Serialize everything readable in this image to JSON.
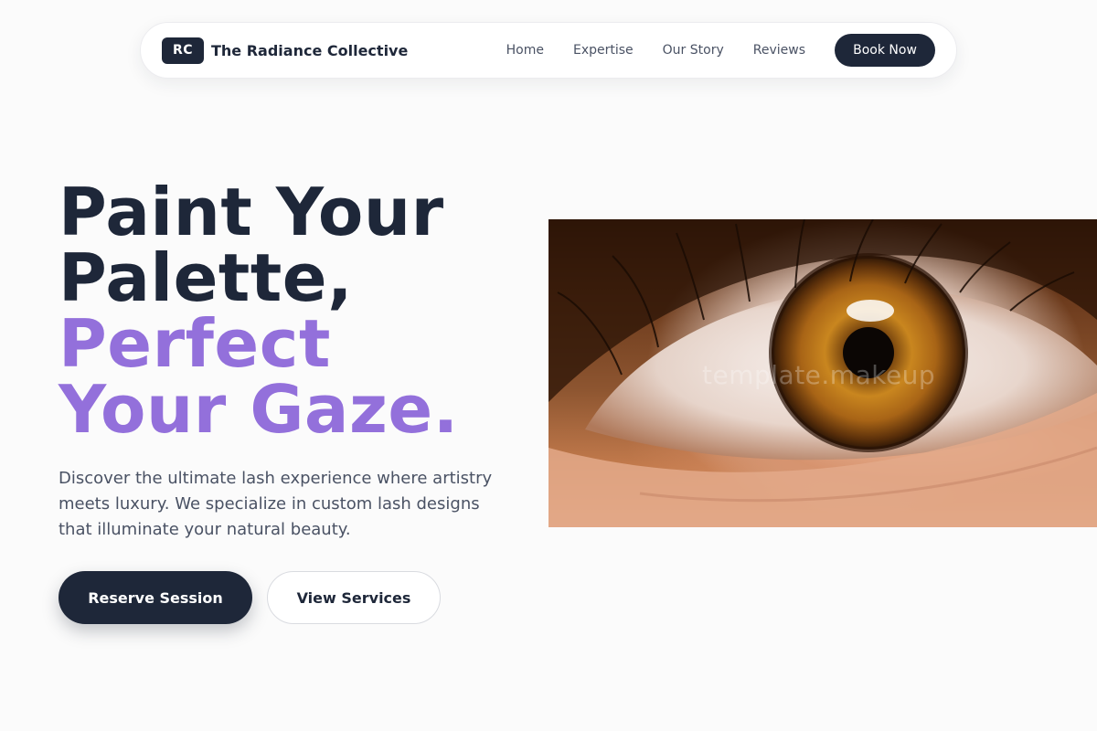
{
  "nav": {
    "logo_initials": "RC",
    "brand_name": "The Radiance Collective",
    "links": [
      "Home",
      "Expertise",
      "Our Story",
      "Reviews"
    ],
    "cta_label": "Book Now"
  },
  "hero": {
    "headline_dark": [
      "Paint Your",
      "Palette,"
    ],
    "headline_accent": [
      "Perfect",
      "Your Gaze."
    ],
    "description": "Discover the ultimate lash experience where artistry meets luxury. We specialize in custom lash designs that illuminate your natural beauty.",
    "primary_cta": "Reserve Session",
    "secondary_cta": "View Services"
  },
  "image": {
    "subject": "close-up-eye-photo",
    "watermark": "template.makeup"
  },
  "colors": {
    "primary": "#1e2739",
    "accent": "#9370db",
    "background": "#fbfbfb",
    "body_text": "#4a5264"
  }
}
